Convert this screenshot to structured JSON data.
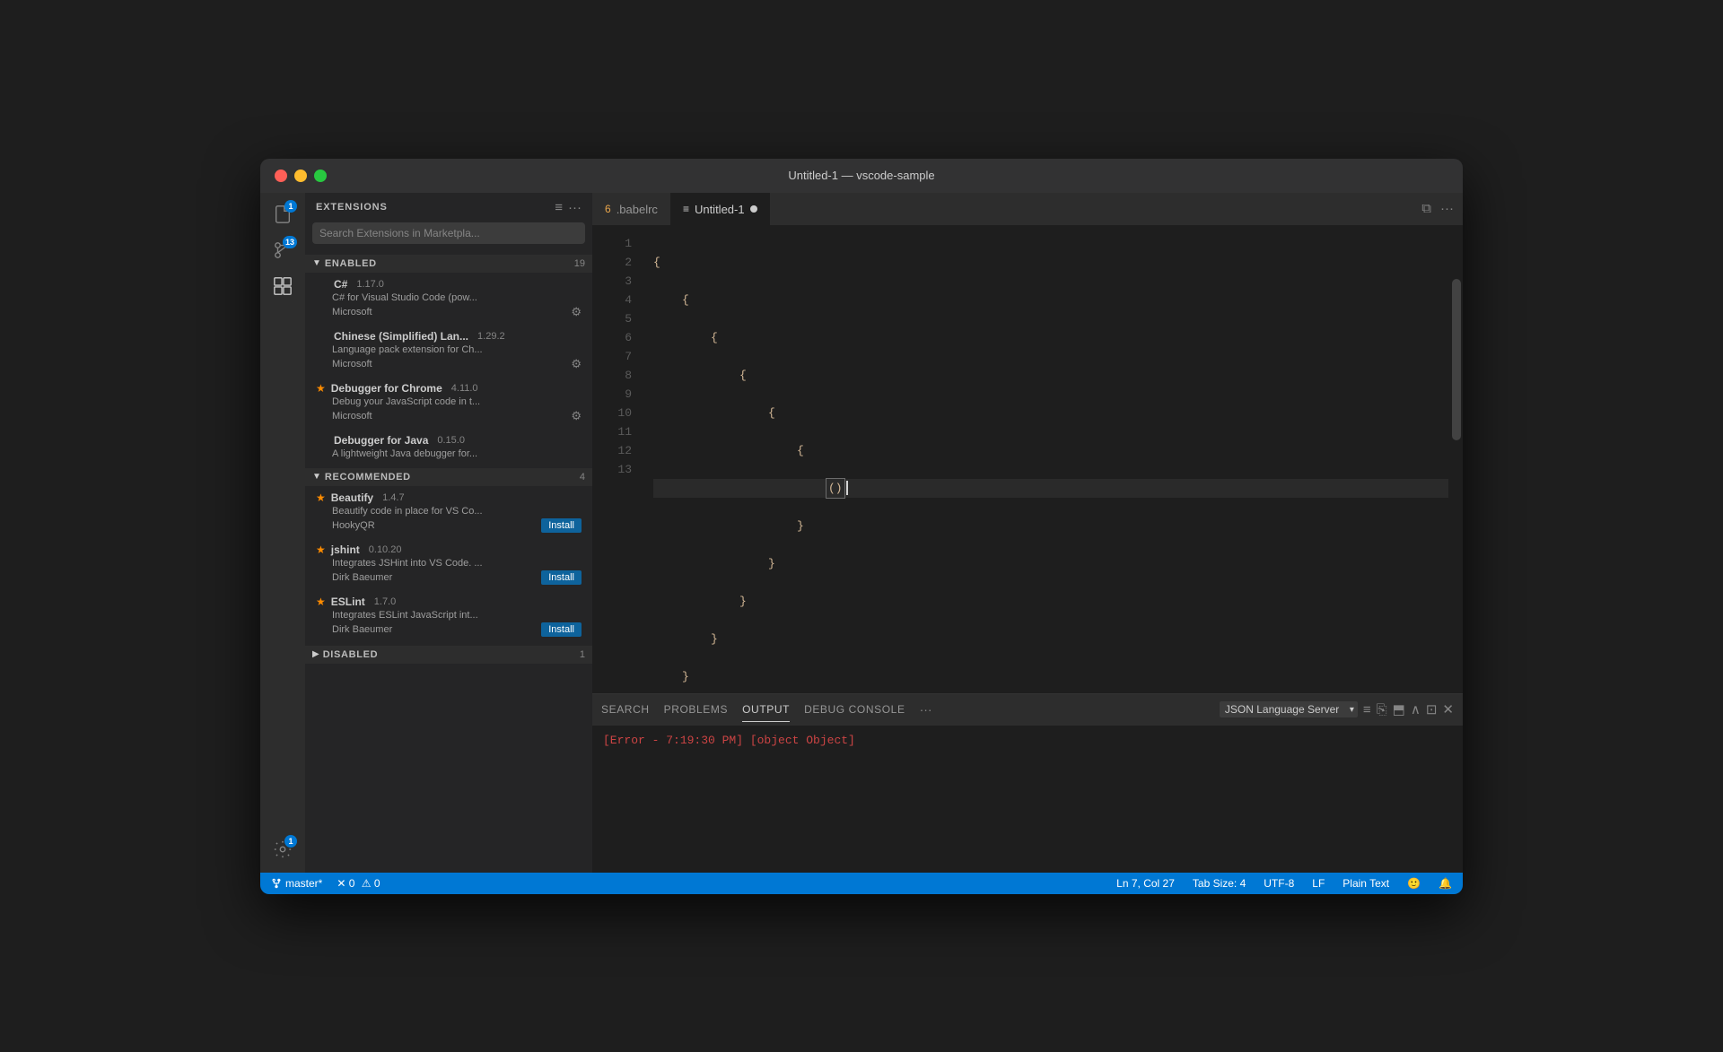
{
  "window": {
    "title": "Untitled-1 — vscode-sample"
  },
  "titlebar": {
    "title": "Untitled-1 — vscode-sample"
  },
  "activity_bar": {
    "icons": [
      {
        "name": "files-icon",
        "symbol": "⎘",
        "active": false,
        "badge": "1"
      },
      {
        "name": "source-control-icon",
        "symbol": "⑂",
        "active": false,
        "badge": "13"
      },
      {
        "name": "extensions-icon",
        "symbol": "⊞",
        "active": true,
        "badge": null
      }
    ],
    "bottom_icons": [
      {
        "name": "settings-icon",
        "symbol": "⚙",
        "badge": "1"
      }
    ]
  },
  "sidebar": {
    "header": "EXTENSIONS",
    "search_placeholder": "Search Extensions in Marketpla...",
    "sections": [
      {
        "title": "ENABLED",
        "count": "19",
        "expanded": true,
        "extensions": [
          {
            "name": "C#",
            "version": "1.17.0",
            "desc": "C# for Visual Studio Code (pow...",
            "publisher": "Microsoft",
            "has_gear": true,
            "starred": false
          },
          {
            "name": "Chinese (Simplified) Lan...",
            "version": "1.29.2",
            "desc": "Language pack extension for Ch...",
            "publisher": "Microsoft",
            "has_gear": true,
            "starred": false
          },
          {
            "name": "Debugger for Chrome",
            "version": "4.11.0",
            "desc": "Debug your JavaScript code in t...",
            "publisher": "Microsoft",
            "has_gear": true,
            "starred": true
          },
          {
            "name": "Debugger for Java",
            "version": "0.15.0",
            "desc": "A lightweight Java debugger for...",
            "publisher": "",
            "has_gear": false,
            "starred": false
          }
        ]
      },
      {
        "title": "RECOMMENDED",
        "count": "4",
        "expanded": true,
        "extensions": [
          {
            "name": "Beautify",
            "version": "1.4.7",
            "desc": "Beautify code in place for VS Co...",
            "publisher": "HookyQR",
            "install": true,
            "starred": true
          },
          {
            "name": "jshint",
            "version": "0.10.20",
            "desc": "Integrates JSHint into VS Code. ...",
            "publisher": "Dirk Baeumer",
            "install": true,
            "starred": true
          },
          {
            "name": "ESLint",
            "version": "1.7.0",
            "desc": "Integrates ESLint JavaScript int...",
            "publisher": "Dirk Baeumer",
            "install": true,
            "starred": true
          }
        ]
      },
      {
        "title": "DISABLED",
        "count": "1",
        "expanded": false
      }
    ]
  },
  "tabs": [
    {
      "label": ".babelrc",
      "icon": "6",
      "active": false
    },
    {
      "label": "Untitled-1",
      "icon": "≡",
      "active": true,
      "modified": true
    }
  ],
  "editor": {
    "lines": [
      {
        "num": 1,
        "content": "{",
        "indent": 0
      },
      {
        "num": 2,
        "content": "{",
        "indent": 8
      },
      {
        "num": 3,
        "content": "{",
        "indent": 16
      },
      {
        "num": 4,
        "content": "{",
        "indent": 24
      },
      {
        "num": 5,
        "content": "{",
        "indent": 32
      },
      {
        "num": 6,
        "content": "{",
        "indent": 40
      },
      {
        "num": 7,
        "content": "()",
        "indent": 48,
        "current": true
      },
      {
        "num": 8,
        "content": "}",
        "indent": 40
      },
      {
        "num": 9,
        "content": "}",
        "indent": 32
      },
      {
        "num": 10,
        "content": "}",
        "indent": 24
      },
      {
        "num": 11,
        "content": "}",
        "indent": 16
      },
      {
        "num": 12,
        "content": "}",
        "indent": 8
      },
      {
        "num": 13,
        "content": "}",
        "indent": 0
      }
    ]
  },
  "panel": {
    "tabs": [
      "SEARCH",
      "PROBLEMS",
      "OUTPUT",
      "DEBUG CONSOLE"
    ],
    "active_tab": "OUTPUT",
    "output_source": "JSON Language Server",
    "error_text": "[Error - 7:19:30 PM] [object Object]"
  },
  "status_bar": {
    "branch": "master*",
    "errors": "0",
    "warnings": "0",
    "position": "Ln 7, Col 27",
    "tab_size": "Tab Size: 4",
    "encoding": "UTF-8",
    "line_ending": "LF",
    "language": "Plain Text"
  }
}
